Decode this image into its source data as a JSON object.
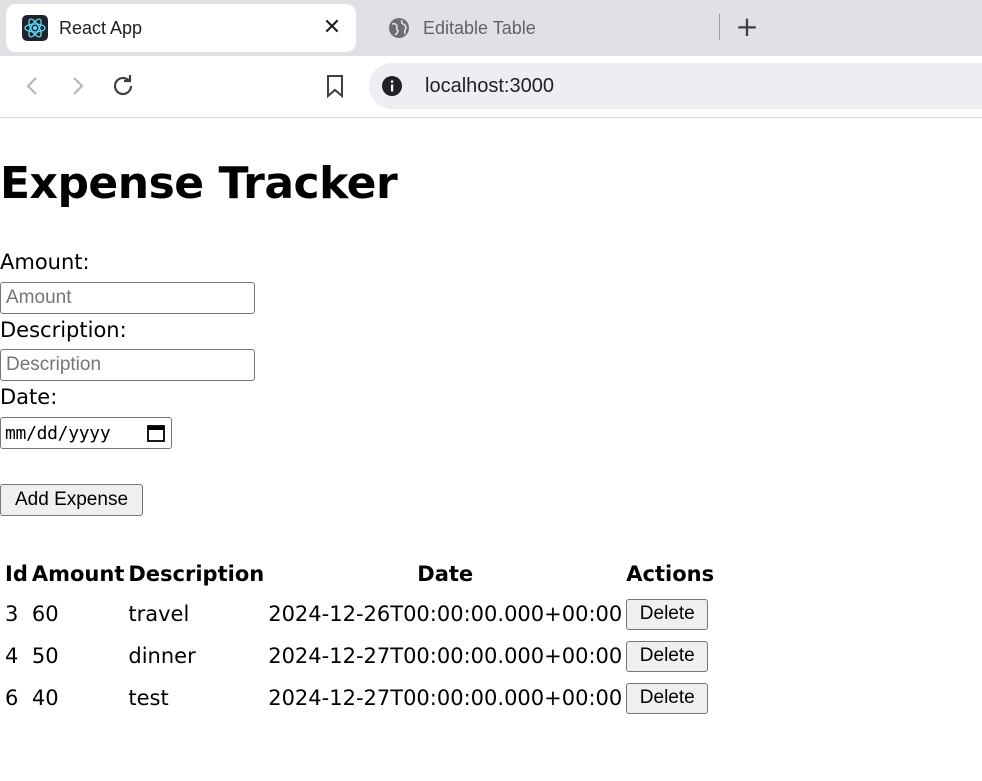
{
  "browser": {
    "tabs": [
      {
        "title": "React App",
        "icon": "react-icon",
        "active": true
      },
      {
        "title": "Editable Table",
        "icon": "globe-icon",
        "active": false
      }
    ],
    "close_glyph": "✕",
    "new_tab_glyph": "+",
    "address": "localhost:3000"
  },
  "page": {
    "title": "Expense Tracker",
    "form": {
      "amount_label": "Amount:",
      "amount_placeholder": "Amount",
      "description_label": "Description:",
      "description_placeholder": "Description",
      "date_label": "Date:",
      "date_placeholder": "mm/dd/yyyy",
      "submit_label": "Add Expense"
    },
    "table": {
      "headers": [
        "Id",
        "Amount",
        "Description",
        "Date",
        "Actions"
      ],
      "rows": [
        {
          "id": "3",
          "amount": "60",
          "description": "travel",
          "date": "2024-12-26T00:00:00.000+00:00",
          "action": "Delete"
        },
        {
          "id": "4",
          "amount": "50",
          "description": "dinner",
          "date": "2024-12-27T00:00:00.000+00:00",
          "action": "Delete"
        },
        {
          "id": "6",
          "amount": "40",
          "description": "test",
          "date": "2024-12-27T00:00:00.000+00:00",
          "action": "Delete"
        }
      ]
    }
  },
  "colors": {
    "tabbar_bg": "#dfe1e5",
    "omnibox_bg": "#eceef1",
    "react_icon": "#61dafb",
    "button_bg": "#efefef"
  }
}
